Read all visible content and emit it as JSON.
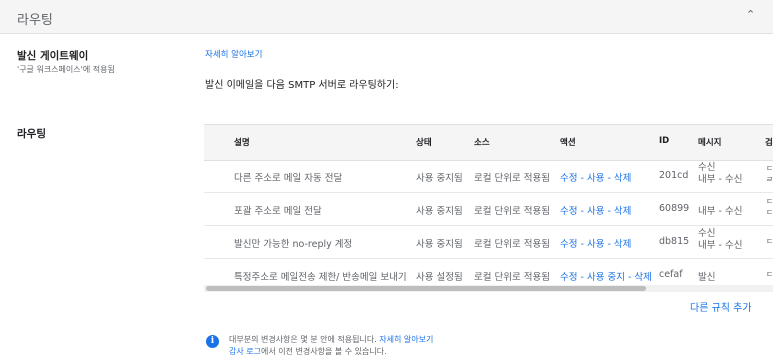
{
  "header": {
    "title": "라우팅",
    "collapse_icon": "chevron-up-icon"
  },
  "outbound": {
    "title": "발신 게이트웨이",
    "subtitle": "'구글 워크스페이스'에 적용됨",
    "learn_more": "자세히 알아보기",
    "description": "발신 이메일을 다음 SMTP 서버로 라우팅하기:"
  },
  "routing": {
    "title": "라우팅",
    "columns": [
      "설명",
      "상태",
      "소스",
      "액션",
      "ID",
      "메시지",
      "검"
    ],
    "rows": [
      {
        "description": "다른 주소로 메일 자동 전달",
        "status": "사용 중지됨",
        "source": "로컬 단위로 적용됨",
        "actions": [
          "수정",
          "사용",
          "삭제"
        ],
        "id": "201cd",
        "message": [
          "수신",
          "내부 - 수신"
        ],
        "extra": [
          "ㄷ",
          "ㄹ"
        ]
      },
      {
        "description": "포괄 주소로 메일 전달",
        "status": "사용 중지됨",
        "source": "로컬 단위로 적용됨",
        "actions": [
          "수정",
          "사용",
          "삭제"
        ],
        "id": "60899",
        "message": [
          "내부 - 수신"
        ],
        "extra": [
          "ㄷ",
          "ㄷ"
        ]
      },
      {
        "description": "발신만 가능한 no-reply 계정",
        "status": "사용 중지됨",
        "source": "로컬 단위로 적용됨",
        "actions": [
          "수정",
          "사용",
          "삭제"
        ],
        "id": "db815",
        "message": [
          "수신",
          "내부 - 수신"
        ],
        "extra": [
          "ㄷ"
        ]
      },
      {
        "description": "특정주소로 메일전송 제한/ 반송메일 보내기",
        "status": "사용 설정됨",
        "source": "로컬 단위로 적용됨",
        "actions": [
          "수정",
          "사용 중지",
          "삭제"
        ],
        "id": "cefaf",
        "message": [
          "발신"
        ],
        "extra": [
          "ㄷ"
        ]
      }
    ],
    "add_rule": "다른 규칙 추가"
  },
  "footer": {
    "info_icon": "info-icon",
    "line1": "대부분의 변경사항은 몇 분 안에 적용됩니다.",
    "line1_link": "자세히 알아보기",
    "line2_link": "감사 로그",
    "line2": "에서 이전 변경사항을 볼 수 있습니다."
  }
}
